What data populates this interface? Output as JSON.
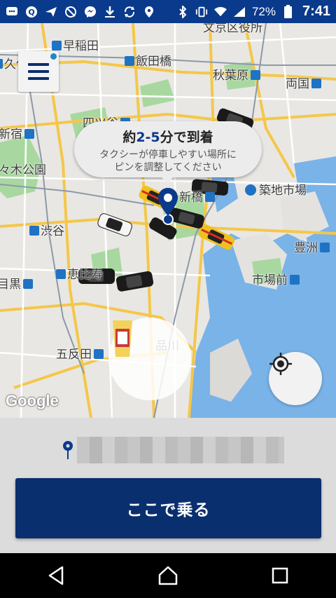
{
  "status_bar": {
    "battery": "72%",
    "time": "7:41",
    "icons": [
      "message-icon",
      "q-icon",
      "send-icon",
      "signal-off-icon",
      "messenger-icon",
      "download-icon",
      "sync-icon",
      "location-icon",
      "bluetooth-icon",
      "vibrate-icon",
      "wifi-icon",
      "cell-signal-icon",
      "battery-icon"
    ]
  },
  "map": {
    "labels": {
      "waseda": "早稲田",
      "iidabashi": "飯田橋",
      "akihabara": "秋葉原",
      "bunkyo": "文京区役所",
      "ryogoku": "両国",
      "shinjuku": "新宿",
      "yotsuya": "四ツ谷",
      "yoyogi": "々木公園",
      "okubo": "久保",
      "shimbashi": "新橋",
      "tsukiji": "築地市場",
      "shibuya": "渋谷",
      "ebisu": "恵比寿",
      "meguro": "目黒",
      "toyosu": "豊洲",
      "shijomae": "市場前",
      "gotanda": "五反田",
      "shinagawa": "品川"
    },
    "google_logo": "Google"
  },
  "bubble": {
    "prefix": "約",
    "eta": "2-5",
    "suffix": "分で到着",
    "line1": "タクシーが停車しやすい場所に",
    "line2": "ピンを調整してください"
  },
  "panel": {
    "ride_button": "ここで乗る"
  },
  "colors": {
    "brand_navy": "#0a2f6e",
    "status_bar": "#0a3a8c"
  }
}
